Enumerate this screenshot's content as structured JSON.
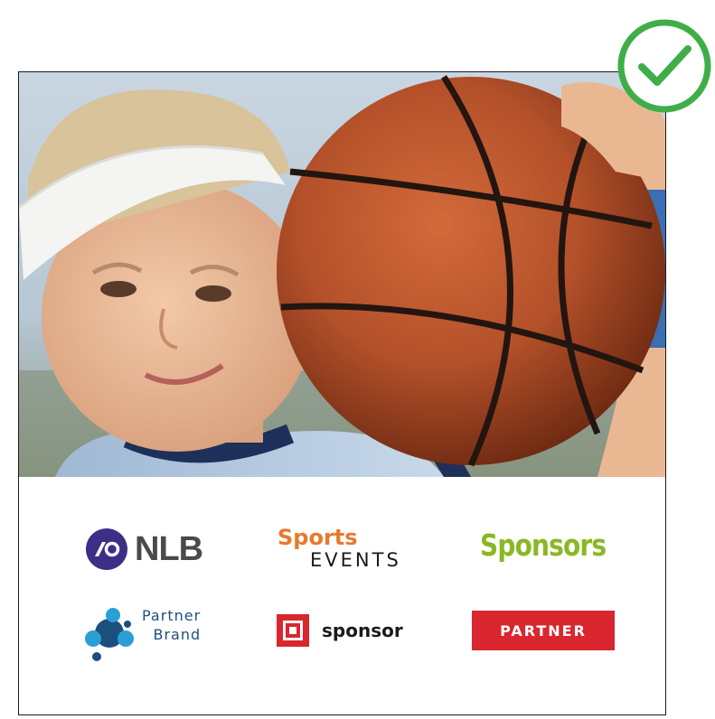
{
  "hero": {
    "image": "boy-with-basketball-photo"
  },
  "badge": {
    "icon": "check-circle-icon",
    "color": "#3fae49"
  },
  "logos": {
    "nlb": {
      "text": "NLB",
      "color": "#3c2f86"
    },
    "sports_events": {
      "line1": "Sports",
      "line2": "EVENTS"
    },
    "sponsors": {
      "text": "Sponsors",
      "color": "#8ab825"
    },
    "partner_brand": {
      "line1": "Partner",
      "line2": "Brand"
    },
    "sponsor": {
      "text": "sponsor",
      "color": "#d9262f"
    },
    "partner": {
      "text": "PARTNER",
      "color": "#d9262f"
    }
  }
}
